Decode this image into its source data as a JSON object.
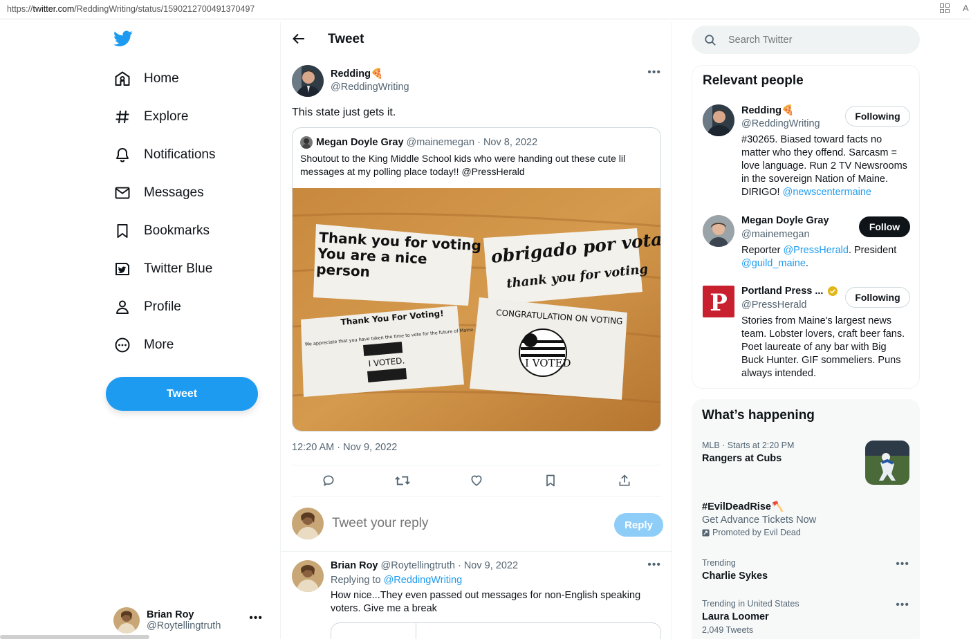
{
  "browser": {
    "url_prefix": "https://",
    "url_domain": "twitter.com",
    "url_path": "/ReddingWriting/status/1590212700491370497"
  },
  "nav": {
    "items": [
      {
        "label": "Home",
        "icon": "home-icon"
      },
      {
        "label": "Explore",
        "icon": "hashtag-icon"
      },
      {
        "label": "Notifications",
        "icon": "bell-icon"
      },
      {
        "label": "Messages",
        "icon": "envelope-icon"
      },
      {
        "label": "Bookmarks",
        "icon": "bookmark-icon"
      },
      {
        "label": "Twitter Blue",
        "icon": "twitter-blue-icon"
      },
      {
        "label": "Profile",
        "icon": "person-icon"
      },
      {
        "label": "More",
        "icon": "more-circle-icon"
      }
    ],
    "tweet_button": "Tweet",
    "account": {
      "name": "Brian Roy",
      "handle": "@Roytellingtruth"
    }
  },
  "header": {
    "title": "Tweet"
  },
  "tweet": {
    "author_name": "Redding🍕",
    "author_handle": "@ReddingWriting",
    "text": "This state just gets it.",
    "timestamp": "12:20 AM · Nov 9, 2022",
    "quote": {
      "name": "Megan Doyle Gray",
      "meta": "@mainemegan · Nov 8, 2022",
      "text": "Shoutout to the King Middle School kids who were handing out these cute lil messages at my polling place today!! @PressHerald",
      "image_cards": {
        "card1": [
          "Thank you for voting",
          "You are a nice",
          "person"
        ],
        "card2": [
          "obrigado por votar",
          "thank you for voting"
        ],
        "card3_title": "Thank You For Voting!",
        "card3_body": "We appreciate that you have taken the time to vote for the future of Maine.",
        "card3_stamp": "I VOTED.",
        "card4_title": "CONGRATULATION ON VOTING",
        "card4_stamp": "I VOTED"
      }
    }
  },
  "reply_box": {
    "placeholder": "Tweet your reply",
    "button": "Reply"
  },
  "reply": {
    "name": "Brian Roy",
    "meta": " @Roytellingtruth · Nov 9, 2022",
    "replying_prefix": "Replying to ",
    "replying_to": "@ReddingWriting",
    "text": "How nice...They even passed out messages for non-English speaking voters. Give me a break"
  },
  "search": {
    "placeholder": "Search Twitter"
  },
  "relevant": {
    "title": "Relevant people",
    "people": [
      {
        "name": "Redding🍕",
        "handle": "@ReddingWriting",
        "button": "Following",
        "bio": "#30265. Biased toward facts no matter who they offend. Sarcasm = love language. Run 2 TV Newsrooms in the sovereign Nation of Maine. DIRIGO! ",
        "bio_link": "@newscentermaine"
      },
      {
        "name": "Megan Doyle Gray",
        "handle": "@mainemegan",
        "button": "Follow",
        "bio_a": "Reporter ",
        "bio_link1": "@PressHerald",
        "bio_b": ". President ",
        "bio_link2": "@guild_maine",
        "bio_c": "."
      },
      {
        "name": "Portland Press ...",
        "handle": "@PressHerald",
        "button": "Following",
        "bio": "Stories from Maine's largest news team. Lobster lovers, craft beer fans. Poet laureate of any bar with Big Buck Hunter. GIF sommeliers. Puns always intended."
      }
    ]
  },
  "happening": {
    "title": "What’s happening",
    "trends": [
      {
        "meta": "MLB · Starts at 2:20 PM",
        "title": "Rangers at Cubs"
      },
      {
        "title": "#EvilDeadRise🪓",
        "sub": "Get Advance Tickets Now",
        "promo": "Promoted by Evil Dead"
      },
      {
        "meta": "Trending",
        "title": "Charlie Sykes"
      },
      {
        "meta": "Trending in United States",
        "title": "Laura Loomer",
        "count": "2,049 Tweets"
      }
    ]
  },
  "colors": {
    "accent": "#1d9bf0",
    "text": "#0f1419",
    "muted": "#536471"
  }
}
